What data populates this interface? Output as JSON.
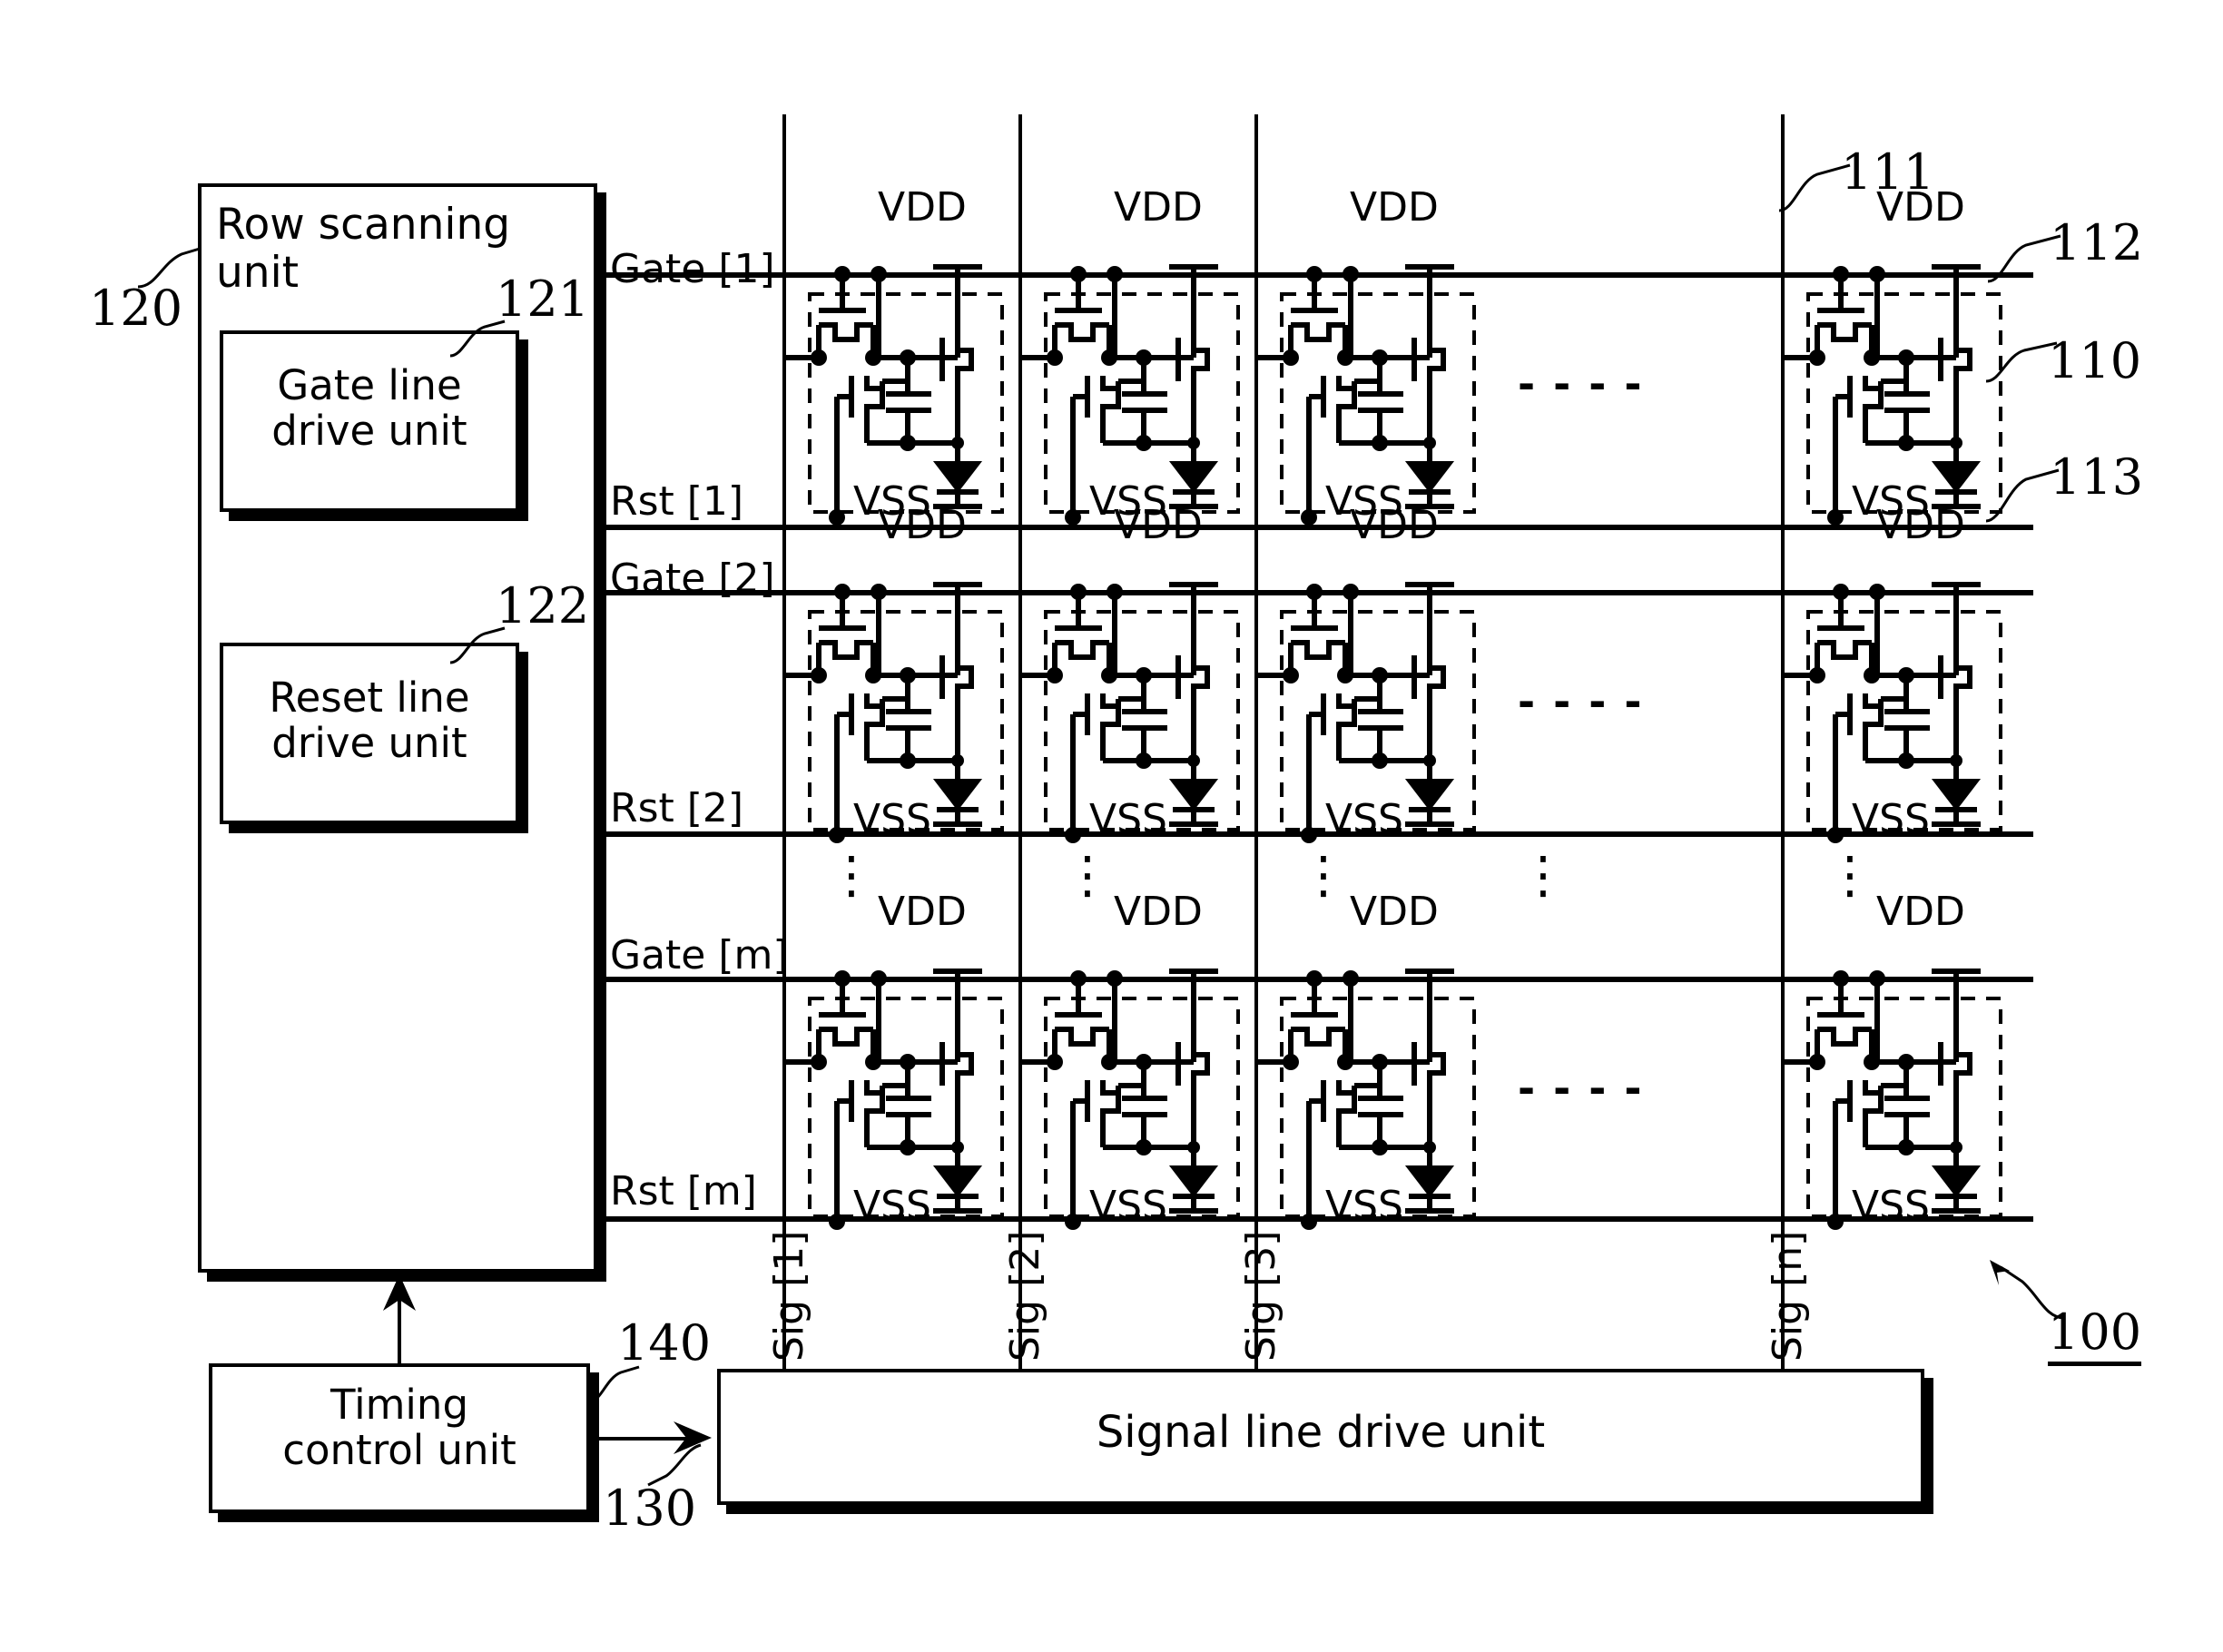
{
  "figure": {
    "device_ref": "100",
    "pixel_area_ref": "111",
    "gate_line_ref": "112",
    "pixel_circuit_ref": "110",
    "reset_line_ref": "113"
  },
  "row_scanning_unit": {
    "label": "Row scanning\nunit",
    "ref": "120",
    "gate_drive": {
      "label": "Gate line\ndrive unit",
      "ref": "121"
    },
    "reset_drive": {
      "label": "Reset line\ndrive unit",
      "ref": "122"
    }
  },
  "timing_control_unit": {
    "label": "Timing\ncontrol unit",
    "ref": "140"
  },
  "signal_line_drive_unit": {
    "label": "Signal line drive unit",
    "ref": "130"
  },
  "rows": [
    {
      "gate": "Gate [1]",
      "rst": "Rst [1]"
    },
    {
      "gate": "Gate [2]",
      "rst": "Rst [2]"
    },
    {
      "gate": "Gate [m]",
      "rst": "Rst [m]"
    }
  ],
  "columns": [
    {
      "sig": "Sig [1]"
    },
    {
      "sig": "Sig [2]"
    },
    {
      "sig": "Sig [3]"
    },
    {
      "sig": "Sig [n]"
    }
  ],
  "pixel": {
    "vdd": "VDD",
    "vss": "VSS"
  },
  "ellipsis": {
    "horizontal": "- - - -",
    "vertical": "⋮"
  },
  "colors": {
    "ink": "#000000",
    "paper": "#ffffff"
  }
}
